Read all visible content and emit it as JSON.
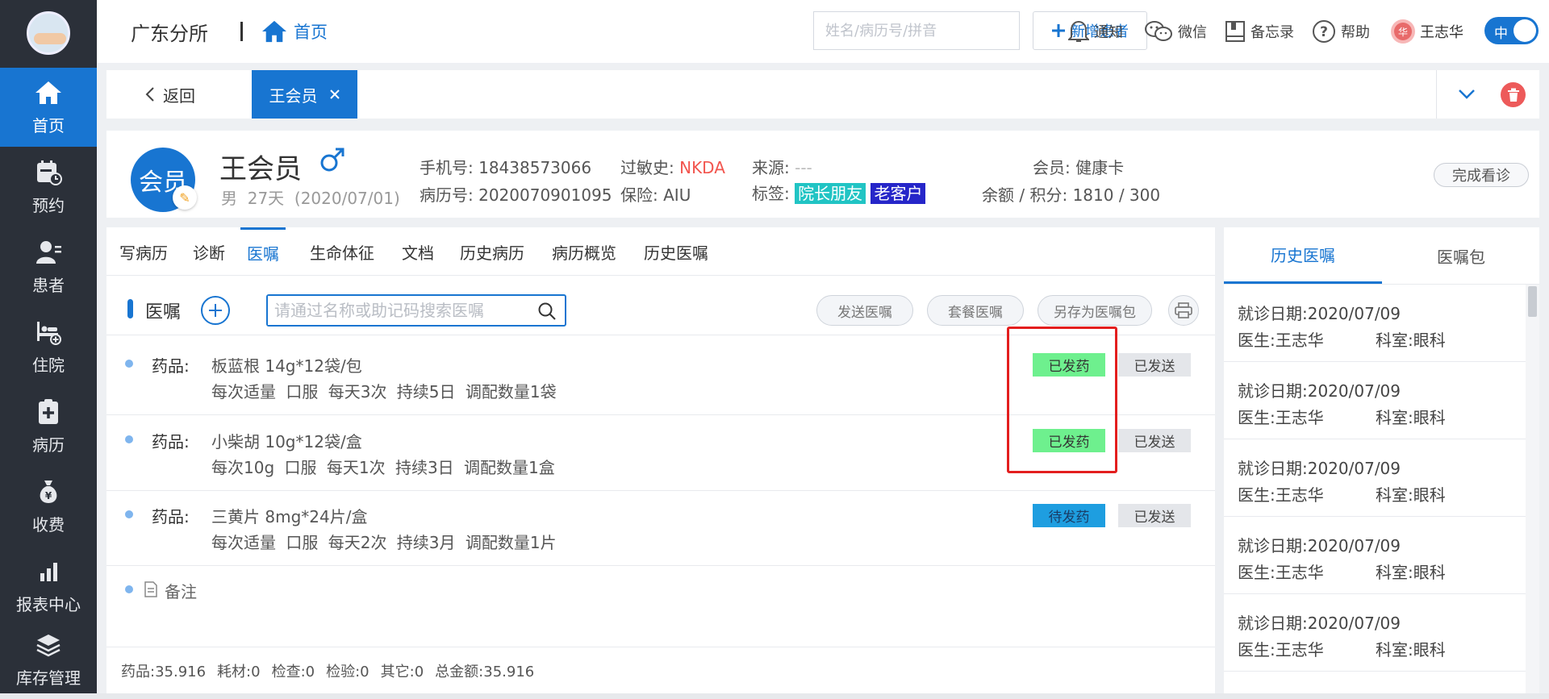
{
  "sidebar": {
    "items": [
      {
        "label": "首页",
        "icon": "home-icon"
      },
      {
        "label": "预约",
        "icon": "calendar-clock-icon"
      },
      {
        "label": "患者",
        "icon": "patient-icon"
      },
      {
        "label": "住院",
        "icon": "hospital-bed-icon"
      },
      {
        "label": "病历",
        "icon": "medical-record-icon"
      },
      {
        "label": "收费",
        "icon": "money-bag-icon"
      },
      {
        "label": "报表中心",
        "icon": "bar-chart-icon"
      },
      {
        "label": "库存管理",
        "icon": "layers-icon"
      }
    ]
  },
  "topbar": {
    "clinic": "广东分所",
    "home": "首页",
    "search_placeholder": "姓名/病历号/拼音",
    "add_patient": "新增患者",
    "notice": "通知",
    "wechat": "微信",
    "memo": "备忘录",
    "help": "帮助",
    "user_badge": "华",
    "user": "王志华",
    "lang": "中"
  },
  "tabbar": {
    "back": "返回",
    "patient_tab": "王会员"
  },
  "patient": {
    "badge": "会员",
    "name": "王会员",
    "gender": "男",
    "age": "27天",
    "birth": "(2020/07/01)",
    "phone_label": "手机号:",
    "phone": "18438573066",
    "record_label": "病历号:",
    "record_no": "2020070901095",
    "allergy_label": "过敏史:",
    "allergy": "NKDA",
    "insurance_label": "保险:",
    "insurance": "AIU",
    "source_label": "来源:",
    "source": "---",
    "tags_label": "标签:",
    "tags": [
      "院长朋友",
      "老客户"
    ],
    "member_label": "会员:",
    "member_card": "健康卡",
    "balance_label": "余额 / 积分:",
    "balance": "1810 / 300",
    "finish_button": "完成看诊"
  },
  "subtabs": [
    "写病历",
    "诊断",
    "医嘱",
    "生命体征",
    "文档",
    "历史病历",
    "病历概览",
    "历史医嘱"
  ],
  "orders_toolbar": {
    "title": "医嘱",
    "search_placeholder": "请通过名称或助记码搜索医嘱",
    "send": "发送医嘱",
    "package": "套餐医嘱",
    "save_as": "另存为医嘱包"
  },
  "orders": [
    {
      "kind": "药品:",
      "name": "板蓝根  14g*12袋/包",
      "usage": "每次适量  口服  每天3次  持续5日  调配数量1袋",
      "dispense": "已发药",
      "sent": "已发送"
    },
    {
      "kind": "药品:",
      "name": "小柴胡  10g*12袋/盒",
      "usage": "每次10g  口服  每天1次  持续3日  调配数量1盒",
      "dispense": "已发药",
      "sent": "已发送"
    },
    {
      "kind": "药品:",
      "name": "三黄片  8mg*24片/盒",
      "usage": "每次适量  口服  每天2次  持续3月  调配数量1片",
      "dispense": "待发药",
      "sent": "已发送"
    }
  ],
  "remark": "备注",
  "totals": {
    "drug": "药品:35.916",
    "material": "耗材:0",
    "exam": "检查:0",
    "test": "检验:0",
    "other": "其它:0",
    "total": "总金额:35.916"
  },
  "right_panel": {
    "tabs": [
      "历史医嘱",
      "医嘱包"
    ],
    "history": [
      {
        "date": "就诊日期:2020/07/09",
        "doctor": "医生:王志华",
        "dept": "科室:眼科"
      },
      {
        "date": "就诊日期:2020/07/09",
        "doctor": "医生:王志华",
        "dept": "科室:眼科"
      },
      {
        "date": "就诊日期:2020/07/09",
        "doctor": "医生:王志华",
        "dept": "科室:眼科"
      },
      {
        "date": "就诊日期:2020/07/09",
        "doctor": "医生:王志华",
        "dept": "科室:眼科"
      },
      {
        "date": "就诊日期:2020/07/09",
        "doctor": "医生:王志华",
        "dept": "科室:眼科"
      }
    ]
  },
  "colors": {
    "primary": "#1875d1",
    "sidebar": "#2b3039",
    "dispensed": "#6ef08e",
    "pending": "#1e9ee0",
    "tag_cyan": "#21c4c4",
    "tag_blue": "#2626c9",
    "alert_red": "#f2554e"
  }
}
